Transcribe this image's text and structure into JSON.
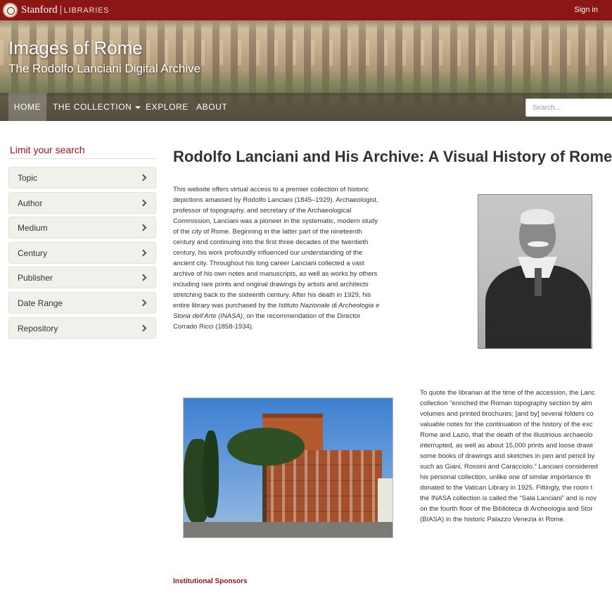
{
  "header": {
    "brand_name": "Stanford",
    "brand_unit": "LIBRARIES",
    "sign_in": "Sign in"
  },
  "masthead": {
    "title": "Images of Rome",
    "subtitle": "The Rodolfo Lanciani Digital Archive"
  },
  "nav": {
    "home": "HOME",
    "collection": "THE COLLECTION",
    "explore": "EXPLORE",
    "about": "ABOUT",
    "search_placeholder": "Search..."
  },
  "sidebar": {
    "heading": "Limit your search",
    "facets": [
      "Topic",
      "Author",
      "Medium",
      "Century",
      "Publisher",
      "Date Range",
      "Repository"
    ]
  },
  "main": {
    "title": "Rodolfo Lanciani and His Archive: A Visual History of Rome",
    "paragraph1_lines": [
      "This website offers virtual access to a premier collection of historic",
      "depictions amassed by Rodolfo Lanciani (1845–1929). Archaeologist,",
      "professor of topography, and secretary of the Archaeological",
      "Commission, Lanciani was a pioneer in the systematic, modern study",
      "of the city of Rome. Beginning in the latter part of the nineteenth",
      "century and continuing into the first three decades of the twentieth",
      "century, his work profoundly influenced our understanding of the",
      "ancient city. Throughout his long career Lanciani collected a vast",
      "archive of his own notes and manuscripts, as well as works by others",
      "including rare prints and original drawings by artists and architects",
      "stretching back to the sixteenth century. After his death in 1929, his"
    ],
    "p1_tail_before": "entire library was purchased by the ",
    "p1_italic_1": "Istituto Nazionale di Archeologia e",
    "p1_italic_2": "Storia dell'Arte (INASA)",
    "p1_tail_after": ", on the recommendation of the Director",
    "p1_last": "Corrado Ricci (1858-1934).",
    "paragraph2_lines": [
      "To quote the librarian at the time of the accession, the Lanc",
      "collection “enriched the Roman topography section by alm",
      "volumes and printed brochures; [and by] several folders co",
      "valuable notes for the continuation of the history of the exc",
      "Rome and Lazio, that the death of the illustrious archaeolo",
      "interrupted, as well as about 15,000 prints and loose drawi",
      "some books of drawings and sketches in pen and pencil by",
      "such as Giani, Rossini and Caracciolo.” Lanciani considered",
      "his personal collection, unlike one of similar importance th",
      "donated to the Vatican Library in 1925. Fittingly, the room t",
      "the INASA collection is called the “Sala Lanciani” and is nov",
      "on the fourth floor of the Biblioteca di Archeologia and Stor",
      "(BIASA) in the historic Palazzo Venezia in Rome."
    ],
    "sponsors_heading": "Institutional Sponsors"
  }
}
